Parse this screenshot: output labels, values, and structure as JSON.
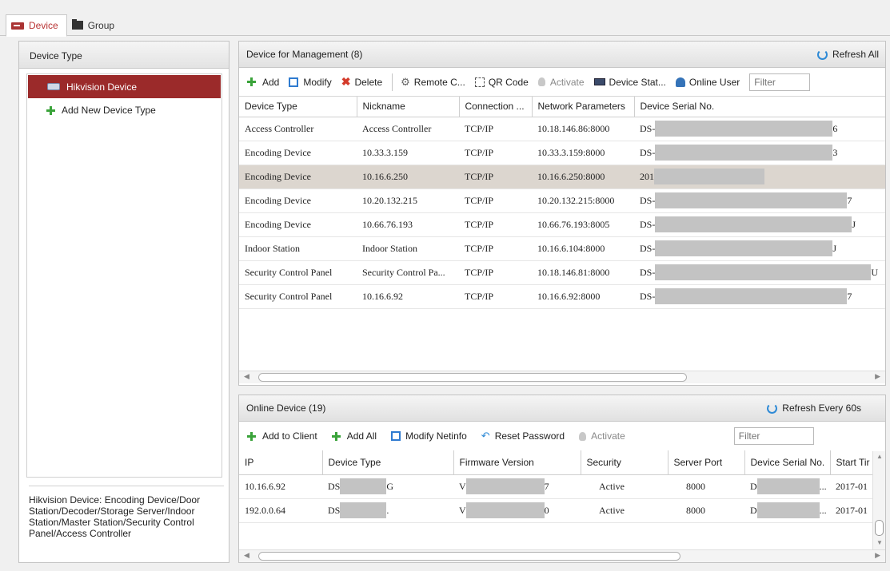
{
  "tabs": [
    {
      "label": "Device",
      "icon": "device-icon"
    },
    {
      "label": "Group",
      "icon": "folder-icon"
    }
  ],
  "left": {
    "title": "Device Type",
    "tree": [
      {
        "label": "Hikvision Device"
      },
      {
        "label": "Add New Device Type"
      }
    ],
    "description": "Hikvision Device: Encoding Device/Door Station/Decoder/Storage Server/Indoor Station/Master Station/Security Control Panel/Access Controller"
  },
  "management": {
    "title": "Device for Management (8)",
    "refresh": "Refresh All",
    "toolbar": {
      "add": "Add",
      "modify": "Modify",
      "delete": "Delete",
      "remote": "Remote C...",
      "qr": "QR Code",
      "activate": "Activate",
      "status": "Device Stat...",
      "online_user": "Online User",
      "filter_placeholder": "Filter"
    },
    "columns": [
      "Device Type",
      "Nickname",
      "Connection ...",
      "Network Parameters",
      "Device Serial No."
    ],
    "rows": [
      {
        "type": "Access Controller",
        "nickname": "Access Controller",
        "conn": "TCP/IP",
        "net": "10.18.146.86:8000",
        "serial_prefix": "DS-",
        "serial_suffix": "6"
      },
      {
        "type": "Encoding Device",
        "nickname": "10.33.3.159",
        "conn": "TCP/IP",
        "net": "10.33.3.159:8000",
        "serial_prefix": "DS-",
        "serial_suffix": "3"
      },
      {
        "type": "Encoding Device",
        "nickname": "10.16.6.250",
        "conn": "TCP/IP",
        "net": "10.16.6.250:8000",
        "serial_prefix": "201",
        "serial_suffix": ""
      },
      {
        "type": "Encoding Device",
        "nickname": "10.20.132.215",
        "conn": "TCP/IP",
        "net": "10.20.132.215:8000",
        "serial_prefix": "DS-",
        "serial_suffix": "7"
      },
      {
        "type": "Encoding Device",
        "nickname": "10.66.76.193",
        "conn": "TCP/IP",
        "net": "10.66.76.193:8005",
        "serial_prefix": "DS-",
        "serial_suffix": "J"
      },
      {
        "type": "Indoor Station",
        "nickname": "Indoor Station",
        "conn": "TCP/IP",
        "net": "10.16.6.104:8000",
        "serial_prefix": "DS-",
        "serial_suffix": "J"
      },
      {
        "type": "Security Control Panel",
        "nickname": "Security Control Pa...",
        "conn": "TCP/IP",
        "net": "10.18.146.81:8000",
        "serial_prefix": "DS-",
        "serial_suffix": "U"
      },
      {
        "type": "Security Control Panel",
        "nickname": "10.16.6.92",
        "conn": "TCP/IP",
        "net": "10.16.6.92:8000",
        "serial_prefix": "DS-",
        "serial_suffix": "7"
      }
    ]
  },
  "online": {
    "title": "Online Device (19)",
    "refresh": "Refresh Every 60s",
    "toolbar": {
      "add_to_client": "Add to Client",
      "add_all": "Add All",
      "modify_netinfo": "Modify Netinfo",
      "reset_password": "Reset Password",
      "activate": "Activate",
      "filter_placeholder": "Filter"
    },
    "columns": [
      "IP",
      "Device Type",
      "Firmware Version",
      "Security",
      "Server Port",
      "Device Serial No.",
      "Start Tir"
    ],
    "rows": [
      {
        "ip": "10.16.6.92",
        "type_prefix": "DS",
        "type_suffix": "G",
        "fw_prefix": "V",
        "fw_suffix": "7",
        "security": "Active",
        "port": "8000",
        "serial_prefix": "D",
        "serial_suffix": "...",
        "start": "2017-01"
      },
      {
        "ip": "192.0.0.64",
        "type_prefix": "DS",
        "type_suffix": ".",
        "fw_prefix": "V",
        "fw_suffix": "0",
        "security": "Active",
        "port": "8000",
        "serial_prefix": "D",
        "serial_suffix": "...",
        "start": "2017-01"
      }
    ]
  }
}
